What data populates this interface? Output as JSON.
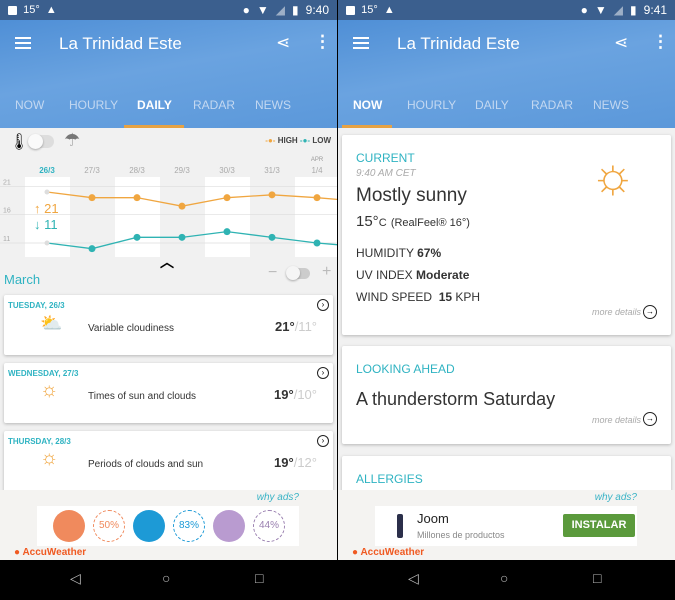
{
  "left": {
    "status": {
      "temp": "15°",
      "time": "9:40"
    },
    "title": "La Trinidad Este",
    "tabs": [
      "NOW",
      "HOURLY",
      "DAILY",
      "RADAR",
      "NEWS"
    ],
    "active_tab": "DAILY",
    "legend": {
      "high": "HIGH",
      "low": "LOW"
    },
    "chart_data": {
      "type": "line",
      "categories": [
        "26/3",
        "27/3",
        "28/3",
        "29/3",
        "30/3",
        "31/3",
        "1/4"
      ],
      "month_marker": "APR",
      "y_ticks": [
        "21",
        "16",
        "11"
      ],
      "ylim": [
        8,
        23
      ],
      "series": [
        {
          "name": "HIGH",
          "color": "#f0a640",
          "values": [
            20,
            19,
            19,
            17.5,
            19,
            19.5,
            19
          ]
        },
        {
          "name": "LOW",
          "color": "#2fb3b3",
          "values": [
            11,
            10,
            12,
            12,
            13,
            12,
            11
          ]
        }
      ],
      "current_high": "↑ 21",
      "current_low": "↓ 11"
    },
    "month": "March",
    "days": [
      {
        "header": "TUESDAY, 26/3",
        "text": "Variable cloudiness",
        "high": "21°",
        "low": "/11°"
      },
      {
        "header": "WEDNESDAY, 27/3",
        "text": "Times of sun and clouds",
        "high": "19°",
        "low": "/10°"
      },
      {
        "header": "THURSDAY, 28/3",
        "text": "Periods of clouds and sun",
        "high": "19°",
        "low": "/12°"
      }
    ],
    "ad": {
      "why": "why ads?",
      "discounts": [
        "50%",
        "83%",
        "44%"
      ],
      "brand": "AccuWeather"
    }
  },
  "right": {
    "status": {
      "temp": "15°",
      "time": "9:41"
    },
    "title": "La Trinidad Este",
    "tabs": [
      "NOW",
      "HOURLY",
      "DAILY",
      "RADAR",
      "NEWS"
    ],
    "active_tab": "NOW",
    "current": {
      "label": "CURRENT",
      "time": "9:40 AM CET",
      "condition": "Mostly sunny",
      "temp": "15°",
      "unit": "C",
      "realfeel": "(RealFeel® 16°)",
      "humidity_label": "HUMIDITY",
      "humidity": "67%",
      "uv_label": "UV INDEX",
      "uv": "Moderate",
      "wind_label": "WIND SPEED",
      "wind": "15",
      "wind_unit": "KPH",
      "more": "more details"
    },
    "ahead": {
      "label": "LOOKING AHEAD",
      "text": "A thunderstorm Saturday",
      "more": "more details"
    },
    "allergies": "ALLERGIES",
    "ad": {
      "why": "why ads?",
      "app": "Joom",
      "sub": "Millones de productos",
      "cta": "INSTALAR",
      "brand": "AccuWeather"
    }
  }
}
